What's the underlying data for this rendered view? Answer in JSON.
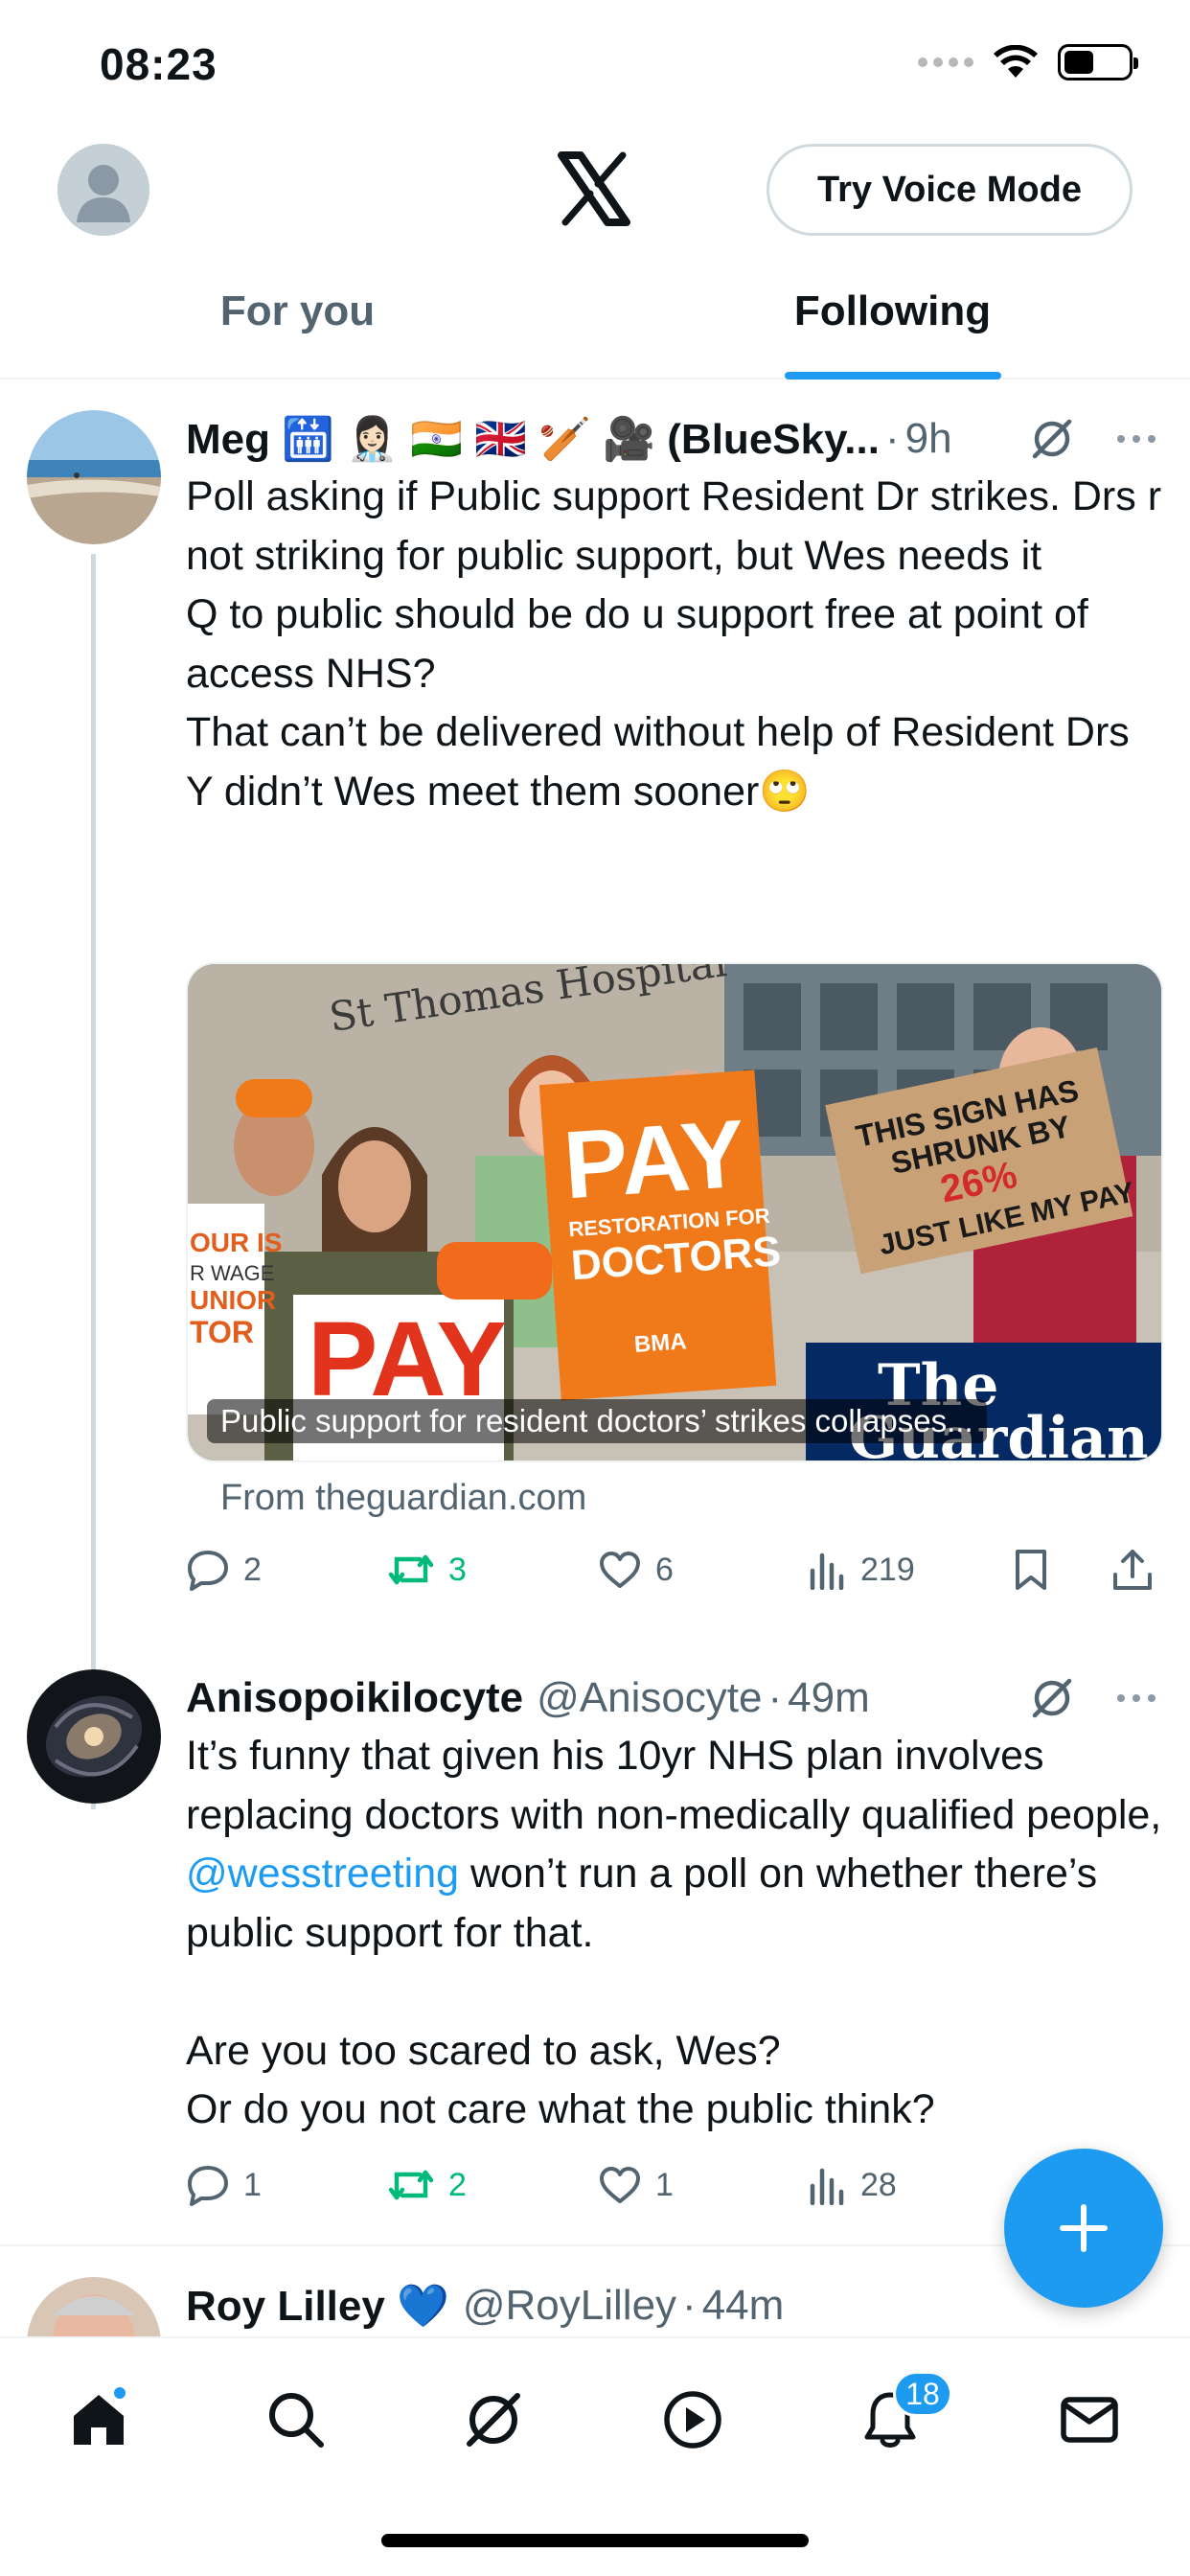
{
  "status_bar": {
    "time": "08:23"
  },
  "header": {
    "voice_mode_label": "Try Voice Mode"
  },
  "tabs": [
    {
      "label": "For you",
      "active": false
    },
    {
      "label": "Following",
      "active": true
    }
  ],
  "posts": [
    {
      "name": "Meg 🛗 👩🏻‍⚕️ 🇮🇳 🇬🇧 🏏 🎥 (BlueSky...",
      "handle": "",
      "time": "9h",
      "text": "Poll asking if Public support Resident Dr strikes. Drs r not striking for public support, but Wes needs it\nQ to public should be do u support free at point of access NHS?\nThat can’t be delivered without help of Resident Drs\nY didn’t Wes meet them sooner🙄",
      "card": {
        "caption": "Public support for resident doctors’ strikes collapses...",
        "source": "From theguardian.com",
        "sign_left": "PAY",
        "sign_left_sub": "RESTORATION FOR DOCTORS",
        "sign_right": "THIS SIGN HAS SHRUNK BY 26% JUST LIKE MY PAY",
        "building": "St Thomas Hospital",
        "logo": "The Guardian",
        "bma": "BMA"
      },
      "replies": "2",
      "reposts": "3",
      "likes": "6",
      "views": "219"
    },
    {
      "name": "Anisopoikilocyte",
      "handle": "@Anisocyte",
      "time": "49m",
      "text_before": "It’s funny that given his 10yr NHS plan involves replacing doctors with non-medically qualified people, ",
      "mention": "@wesstreeting",
      "text_after": " won’t run a poll on whether there’s public support for that.\n\nAre you too scared to ask, Wes?\nOr do you not care what the public think?",
      "replies": "1",
      "reposts": "2",
      "likes": "1",
      "views": "28"
    },
    {
      "name": "Roy Lilley 💙",
      "handle": "@RoyLilley",
      "time": "44m"
    }
  ],
  "nav": {
    "notifications_badge": "18"
  },
  "colors": {
    "accent": "#1d9bf0",
    "repost": "#00ba7c",
    "muted": "#536471"
  }
}
